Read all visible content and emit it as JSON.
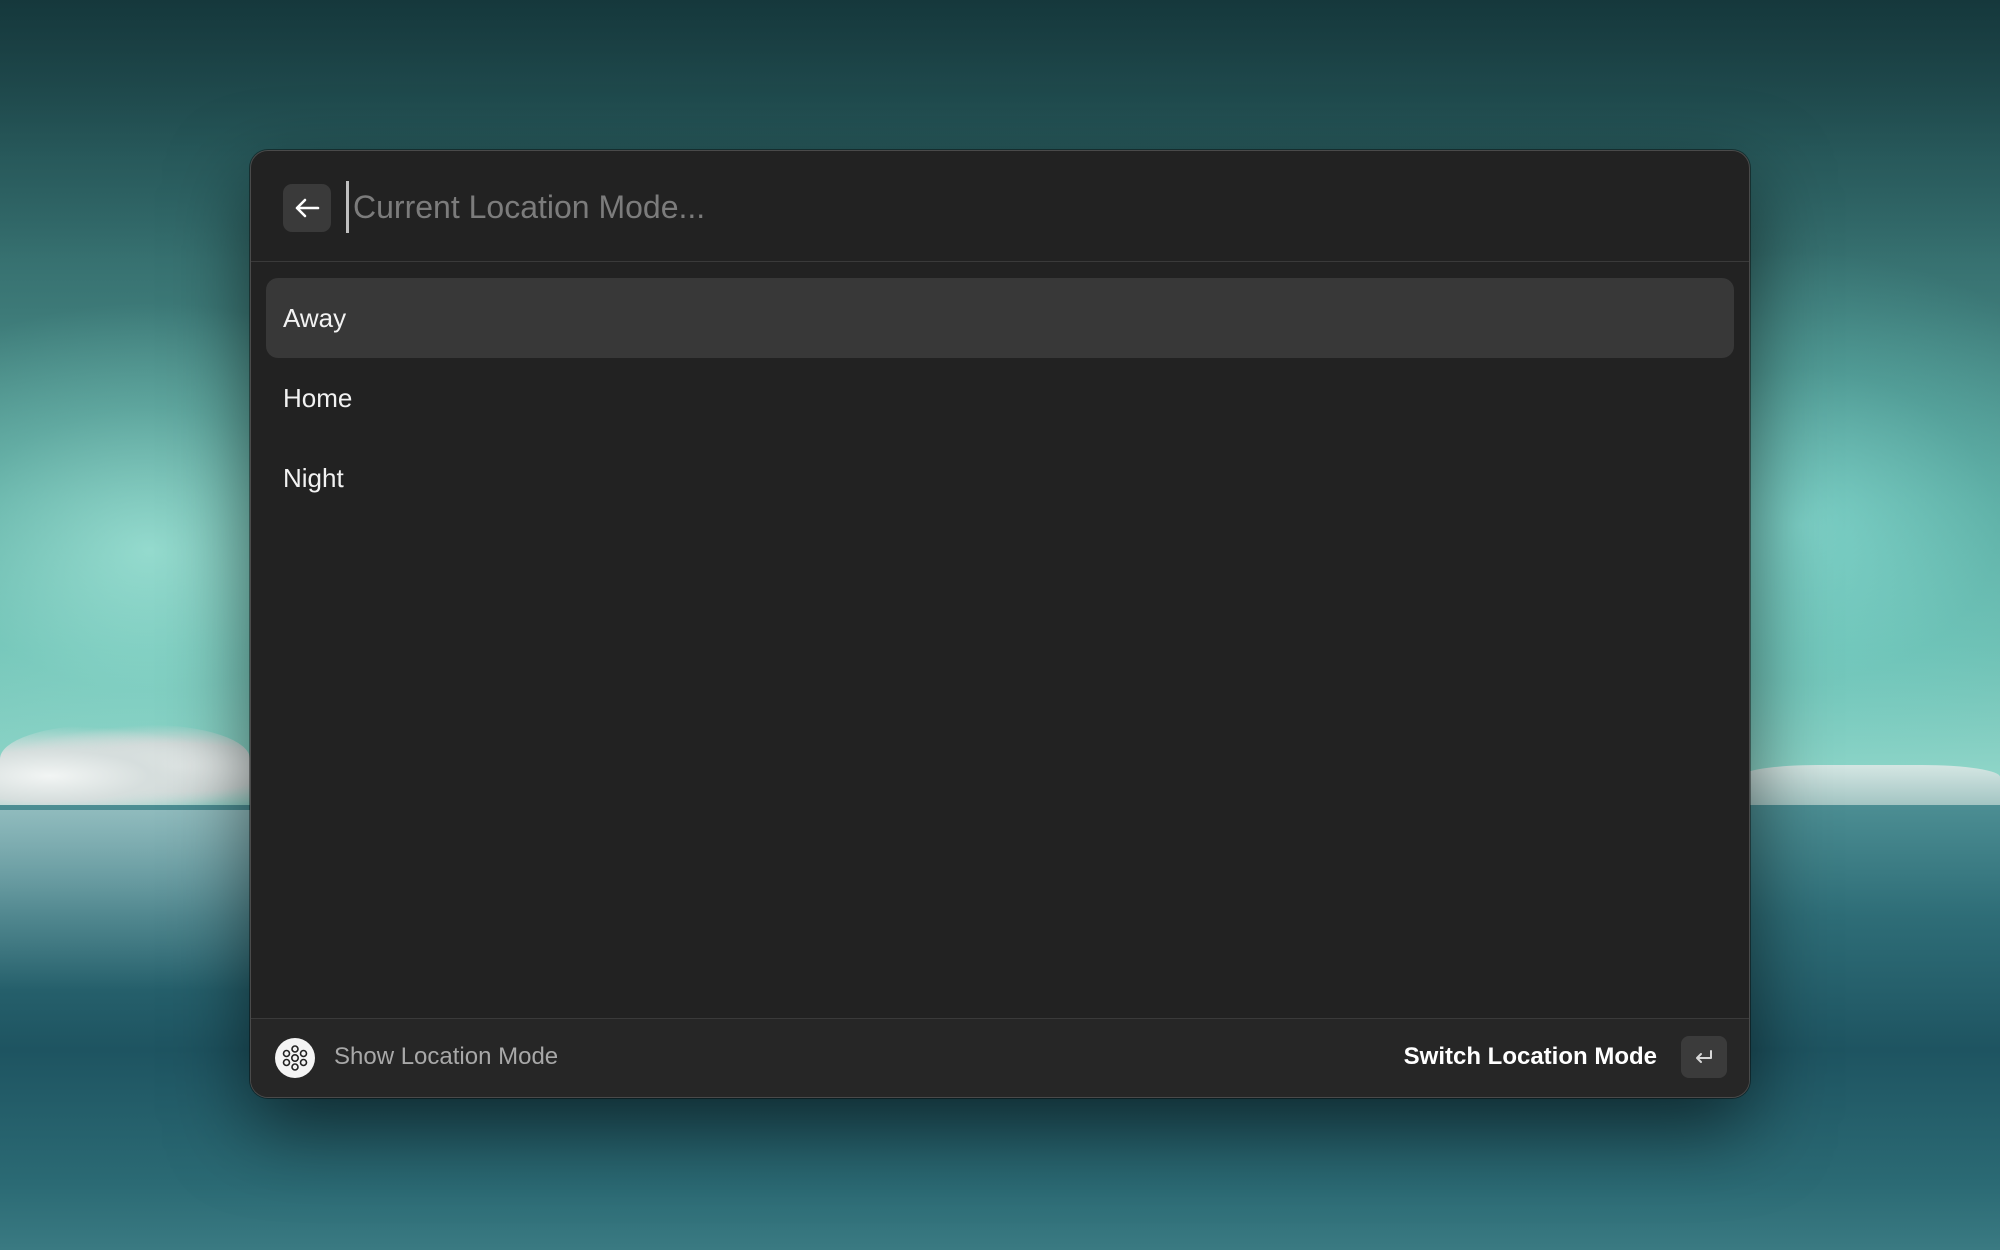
{
  "search": {
    "placeholder": "Current Location Mode...",
    "value": ""
  },
  "back_button": {
    "icon": "arrow-left-icon"
  },
  "list": {
    "items": [
      {
        "label": "Away",
        "selected": true
      },
      {
        "label": "Home",
        "selected": false
      },
      {
        "label": "Night",
        "selected": false
      }
    ]
  },
  "footer": {
    "app_icon": "smartthings-icon",
    "title": "Show Location Mode",
    "action_label": "Switch Location Mode",
    "action_key_icon": "return-key-icon"
  },
  "colors": {
    "window_bg": "#222222",
    "selected_row_bg": "#383838",
    "footer_bg": "#262626"
  }
}
